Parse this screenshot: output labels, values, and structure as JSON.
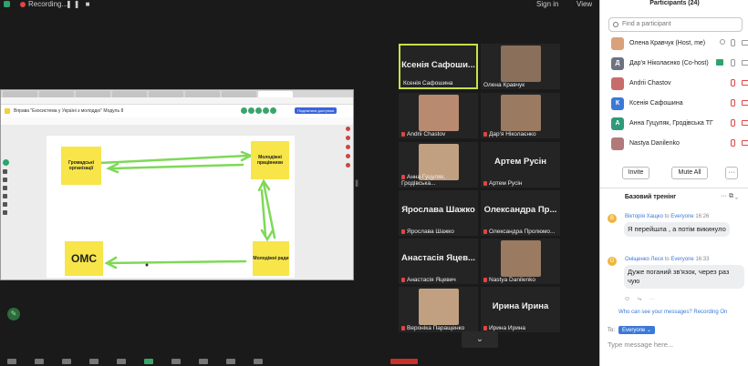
{
  "topbar": {
    "recording": "Recording...",
    "signin": "Sign in",
    "view": "View"
  },
  "share": {
    "board_title": "Вправа \"Екосистема у Україні з молоддю\" Модуль 8",
    "share_button": "Поділитися доступом",
    "notes": [
      {
        "id": "gromadski",
        "text": "Громадські організації"
      },
      {
        "id": "molodizhni-prostory",
        "text": "Молодіжні працівники"
      },
      {
        "id": "omc",
        "text": "ОМС"
      },
      {
        "id": "molodizhni-rady",
        "text": "Молодіжні ради"
      }
    ]
  },
  "video_tiles": [
    {
      "id": "kseniia",
      "display": "Ксенія Сафоши...",
      "label": "Ксенія Сафошина",
      "active": true,
      "muted": false,
      "photo": false
    },
    {
      "id": "olena",
      "display": "",
      "label": "Олена Кравчук",
      "active": false,
      "muted": false,
      "photo": true
    },
    {
      "id": "andrii",
      "display": "",
      "label": "Andrii Chastov",
      "active": false,
      "muted": true,
      "photo": true
    },
    {
      "id": "daria",
      "display": "",
      "label": "Дар'я Ніколаєнко",
      "active": false,
      "muted": true,
      "photo": true
    },
    {
      "id": "anna",
      "display": "",
      "label": "Анна Гуцуляк, Гродівська...",
      "active": false,
      "muted": true,
      "photo": true
    },
    {
      "id": "artem",
      "display": "Артем Русін",
      "label": "Артем Русін",
      "active": false,
      "muted": true,
      "photo": false
    },
    {
      "id": "yaroslava",
      "display": "Ярослава Шажко",
      "label": "Ярослава Шажко",
      "active": false,
      "muted": true,
      "photo": false
    },
    {
      "id": "oleksandra",
      "display": "Олександра Пр...",
      "label": "Олександра Пролюмо...",
      "active": false,
      "muted": true,
      "photo": false
    },
    {
      "id": "anastasia",
      "display": "Анастасія Яцев...",
      "label": "Анастасія Яцевич",
      "active": false,
      "muted": true,
      "photo": false
    },
    {
      "id": "nastya",
      "display": "",
      "label": "Nastya Danilenko",
      "active": false,
      "muted": true,
      "photo": true
    },
    {
      "id": "veronika",
      "display": "",
      "label": "Вероніка Паращенко",
      "active": false,
      "muted": true,
      "photo": true
    },
    {
      "id": "iryna",
      "display": "Ирина Ирина",
      "label": "Ирина Ирина",
      "active": false,
      "muted": true,
      "photo": false
    }
  ],
  "panel": {
    "title": "Participants (24)",
    "search_placeholder": "Find a participant",
    "participants": [
      {
        "name": "Олена Кравчук (Host, me)",
        "initial": "",
        "color": "#d9a07a"
      },
      {
        "name": "Дар'я Ніколаєнко (Co-host)",
        "initial": "Д",
        "color": "#6b7280"
      },
      {
        "name": "Andrii Chastov",
        "initial": "",
        "color": "#c76b6b"
      },
      {
        "name": "Ксенія Сафошина",
        "initial": "К",
        "color": "#3b79d8"
      },
      {
        "name": "Анна Гуцуляк, Гродівська ТГ",
        "initial": "А",
        "color": "#2f9a7a"
      },
      {
        "name": "Nastya Danilenko",
        "initial": "",
        "color": "#b07a7a"
      }
    ],
    "invite": "Invite",
    "mute_all": "Mute All",
    "more": "···",
    "chat_title": "Базовий тренінг",
    "messages": [
      {
        "initial": "В",
        "sender": "Вікторія Хащко",
        "to": "to",
        "recipient": "Everyone",
        "time": "16:26",
        "text": "Я перейшла , а потім викинуло"
      },
      {
        "initial": "О",
        "sender": "Оніщенко Леся",
        "to": "to",
        "recipient": "Everyone",
        "time": "16:33",
        "text": "Дуже поганий зв'язок, через раз чую"
      }
    ],
    "who_can_see": "Who can see your messages? Recording On",
    "to_label": "To:",
    "to_value": "Everyone ⌄",
    "input_placeholder": "Type message here..."
  }
}
